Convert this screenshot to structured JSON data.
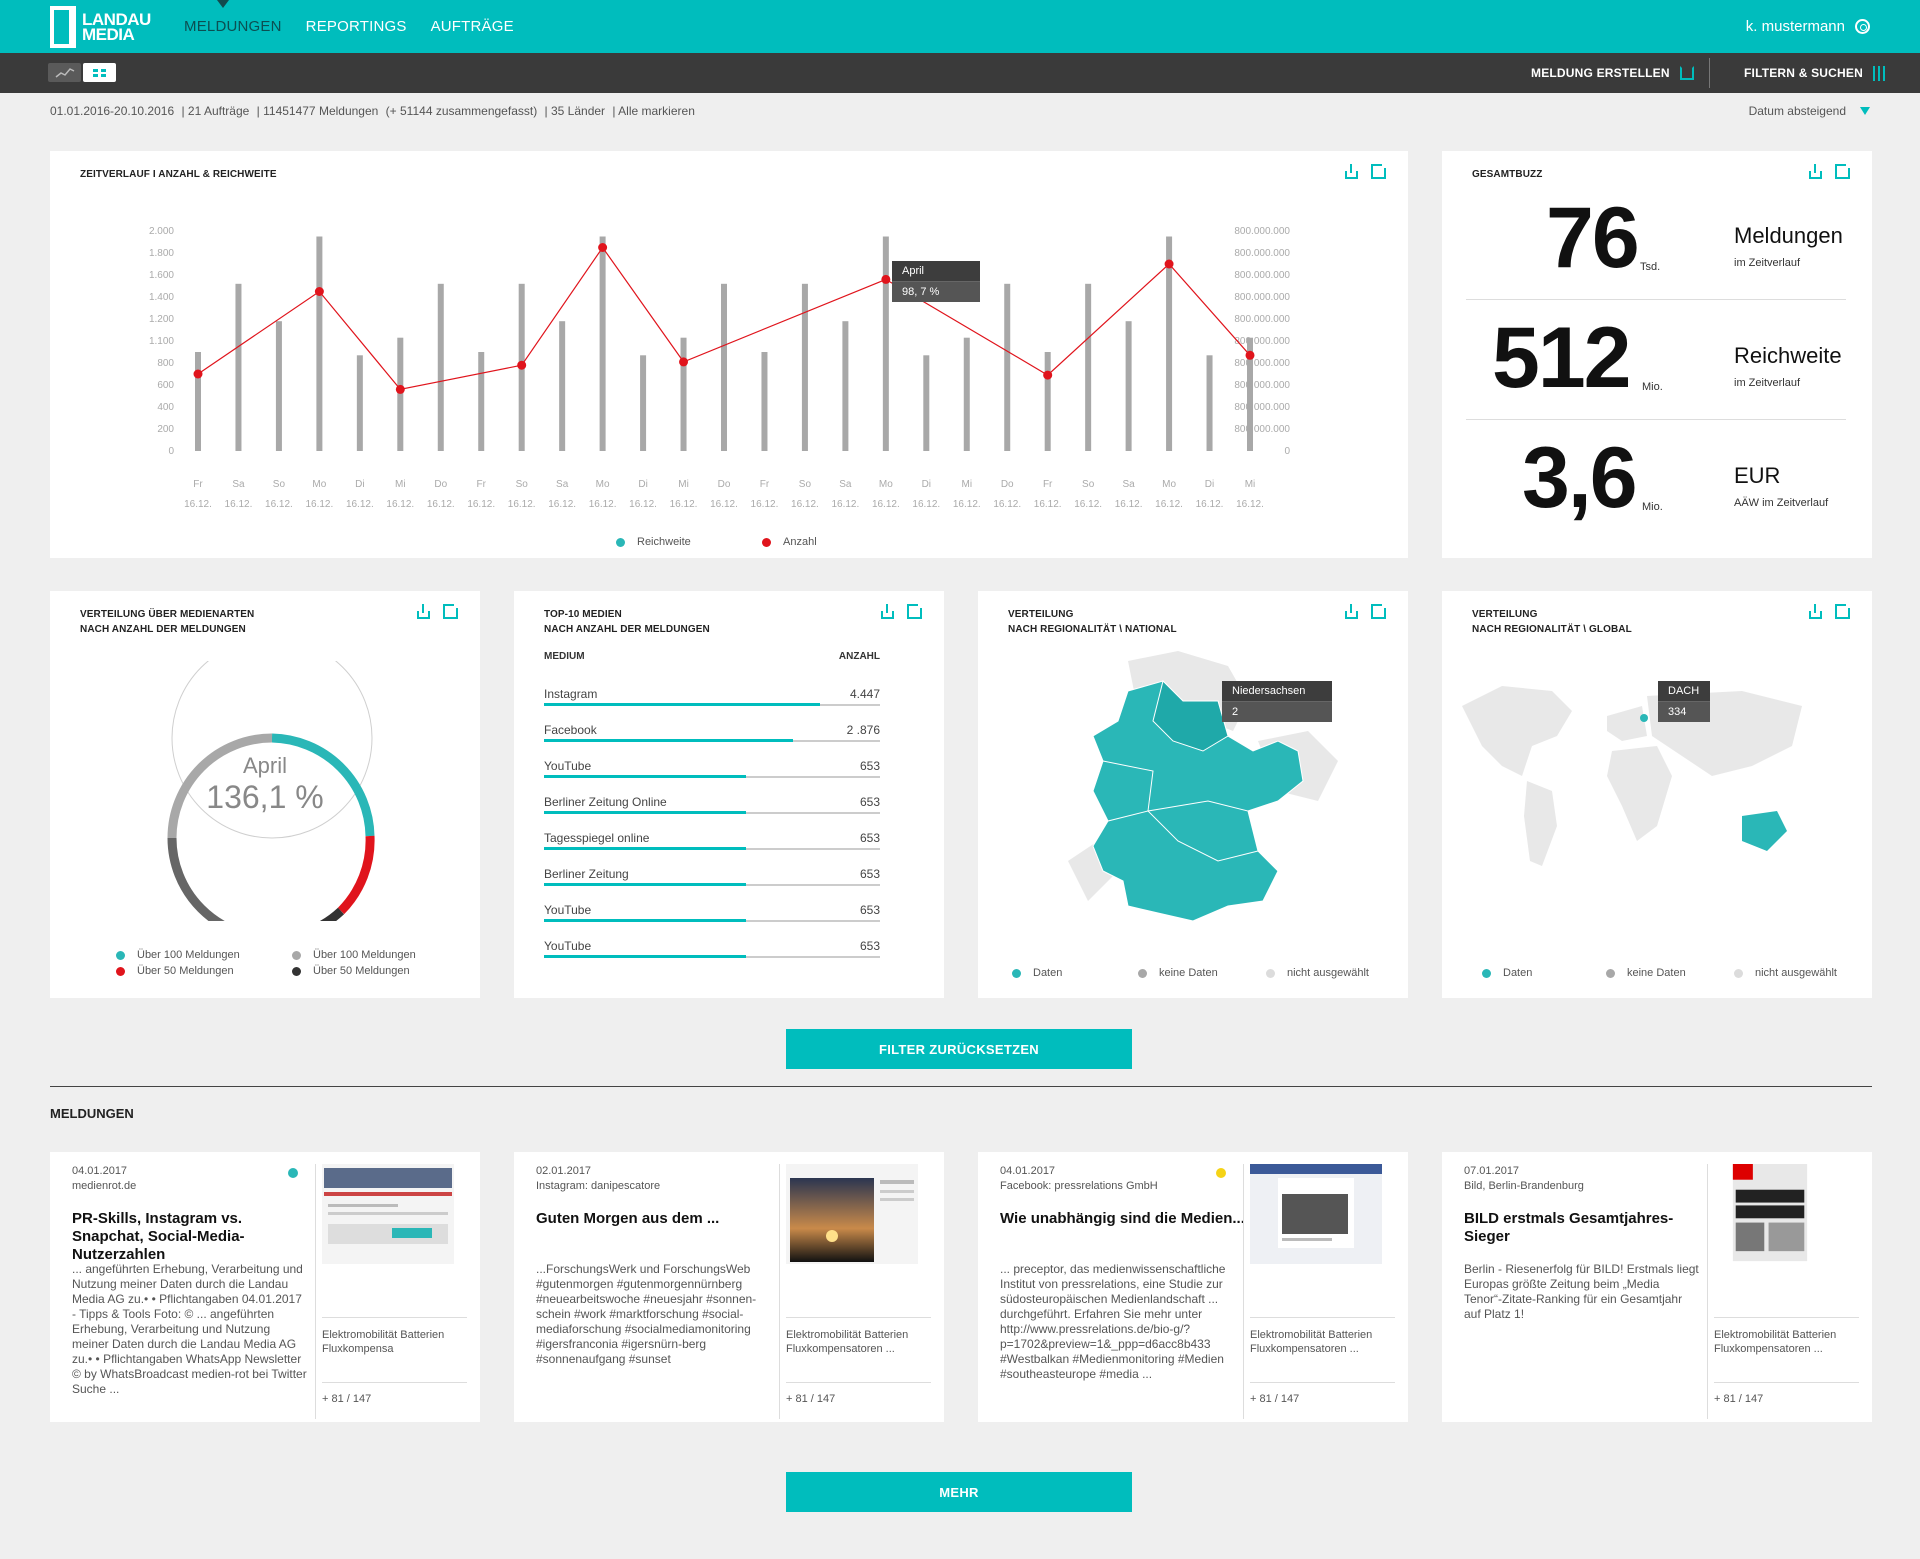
{
  "nav": {
    "logo_line1": "LANDAU",
    "logo_line2": "MEDIA",
    "items": [
      "MELDUNGEN",
      "REPORTINGS",
      "AUFTRÄGE"
    ],
    "active": "MELDUNGEN",
    "user": "k. mustermann"
  },
  "toolbar": {
    "create": "MELDUNG ERSTELLEN",
    "filter": "FILTERN & SUCHEN"
  },
  "filterline": {
    "daterange": "01.01.2016-20.10.2016",
    "auftraege": "21 Aufträge",
    "meldungen": "11451477 Meldungen",
    "summary": "(+ 51144 zusammengefasst)",
    "laender": "35 Länder",
    "mark_all": "Alle markieren",
    "sort": "Datum absteigend"
  },
  "timeline": {
    "title": "ZEITVERLAUF  I  ANZAHL & REICHWEITE",
    "tooltip_label": "April",
    "tooltip_value": "98, 7 %",
    "legend_reach": "Reichweite",
    "legend_count": "Anzahl"
  },
  "chart_data": {
    "type": "bar",
    "left_ticks": [
      "2.000",
      "1.800",
      "1.600",
      "1.400",
      "1.200",
      "1.100",
      "800",
      "600",
      "400",
      "200",
      "0"
    ],
    "right_ticks": [
      "800.000.000",
      "800.000.000",
      "800.000.000",
      "800.000.000",
      "800.000.000",
      "800.000.000",
      "800.000.000",
      "800.000.000",
      "800.000.000",
      "800.000.000",
      "0"
    ],
    "categories": [
      "Fr",
      "Sa",
      "So",
      "Mo",
      "Di",
      "Mi",
      "Do",
      "Fr",
      "So",
      "Sa",
      "Mo",
      "Di",
      "Mi",
      "Do",
      "Fr",
      "So",
      "Sa",
      "Mo",
      "Di",
      "Mi",
      "Do",
      "Fr",
      "So",
      "Sa",
      "Mo",
      "Di",
      "Mi"
    ],
    "dates": [
      "16.12.",
      "16.12.",
      "16.12.",
      "16.12.",
      "16.12.",
      "16.12.",
      "16.12.",
      "16.12.",
      "16.12.",
      "16.12.",
      "16.12.",
      "16.12.",
      "16.12.",
      "16.12.",
      "16.12.",
      "16.12.",
      "16.12.",
      "16.12.",
      "16.12.",
      "16.12.",
      "16.12.",
      "16.12.",
      "16.12.",
      "16.12.",
      "16.12.",
      "16.12.",
      "16.12."
    ],
    "series": [
      {
        "name": "Reichweite",
        "color": "#a8a8a8",
        "values": [
          900,
          1520,
          1180,
          1950,
          870,
          1030,
          1520,
          900,
          1520,
          1180,
          1950,
          870,
          1030,
          1520,
          900,
          1520,
          1180,
          1950,
          870,
          1030,
          1520,
          900,
          1520,
          1180,
          1950,
          870,
          1030
        ]
      },
      {
        "name": "Anzahl",
        "color": "#e0141c",
        "points": [
          [
            0,
            700
          ],
          [
            3,
            1450
          ],
          [
            5,
            560
          ],
          [
            8,
            780
          ],
          [
            10,
            1850
          ],
          [
            12,
            810
          ],
          [
            17,
            1560
          ],
          [
            21,
            690
          ],
          [
            24,
            1700
          ],
          [
            26,
            870
          ]
        ]
      }
    ],
    "ylim": [
      0,
      2000
    ]
  },
  "buzz": {
    "title": "GESAMTBUZZ",
    "k1_value": "76",
    "k1_unit": "Tsd.",
    "k1_label": "Meldungen",
    "k1_sub": "im Zeitverlauf",
    "k2_value": "512",
    "k2_unit": "Mio.",
    "k2_label": "Reichweite",
    "k2_sub": "im Zeitverlauf",
    "k3_value": "3,6",
    "k3_unit": "Mio.",
    "k3_label": "EUR",
    "k3_sub": "AÄW im Zeitverlauf"
  },
  "mediatypes": {
    "title1": "VERTEILUNG ÜBER MEDIENARTEN",
    "title2": "NACH ANZAHL DER MELDUNGEN",
    "center_label": "April",
    "center_value": "136,1 %",
    "legend": [
      {
        "label": "Über 100 Meldungen",
        "color": "#2ab7b7"
      },
      {
        "label": "Über 100 Meldungen",
        "color": "#a8a8a8"
      },
      {
        "label": "Über 50 Meldungen",
        "color": "#e0141c"
      },
      {
        "label": "Über 50 Meldungen",
        "color": "#333333"
      }
    ]
  },
  "top10": {
    "title1": "TOP-10 MEDIEN",
    "title2": "NACH ANZAHL DER MELDUNGEN",
    "col_medium": "MEDIUM",
    "col_count": "ANZAHL",
    "rows": [
      {
        "name": "Instagram",
        "value": "4.447",
        "fill": 0.82
      },
      {
        "name": "Facebook",
        "value": "2 .876",
        "fill": 0.74
      },
      {
        "name": "YouTube",
        "value": "653",
        "fill": 0.6
      },
      {
        "name": "Berliner Zeitung Online",
        "value": "653",
        "fill": 0.6
      },
      {
        "name": "Tagesspiegel online",
        "value": "653",
        "fill": 0.6
      },
      {
        "name": "Berliner Zeitung",
        "value": "653",
        "fill": 0.6
      },
      {
        "name": "YouTube",
        "value": "653",
        "fill": 0.6
      },
      {
        "name": "YouTube",
        "value": "653",
        "fill": 0.6
      }
    ]
  },
  "national": {
    "title1": "VERTEILUNG",
    "title2": "NACH REGIONALITÄT \\ NATIONAL",
    "tip_label": "Niedersachsen",
    "tip_value": "2",
    "legend": [
      "Daten",
      "keine Daten",
      "nicht ausgewählt"
    ]
  },
  "global": {
    "title1": "VERTEILUNG",
    "title2": "NACH REGIONALITÄT \\ GLOBAL",
    "tip_label": "DACH",
    "tip_value": "334",
    "legend": [
      "Daten",
      "keine Daten",
      "nicht ausgewählt"
    ]
  },
  "buttons": {
    "reset": "FILTER ZURÜCKSETZEN",
    "more": "MEHR"
  },
  "news": {
    "section": "MELDUNGEN",
    "items": [
      {
        "date": "04.01.2017",
        "source": "medienrot.de",
        "title": "PR-Skills, Instagram vs. Snapchat, Social-Media-Nutzerzahlen",
        "body": "... angeführten Erhebung, Verarbeitung und Nutzung meiner Daten durch die Landau Media AG zu.• • Pflichtangaben 04.01.2017 - Tipps & Tools Foto: © ... angeführten Erhebung, Verarbeitung und Nutzung meiner Daten durch die Landau Media AG zu.• • Pflichtangaben WhatsApp Newsletter © by WhatsBroadcast medien-rot bei Twitter Suche ...",
        "tags": "Elektromobilität Batterien Fluxkompensa",
        "count": "+ 81 / 147",
        "dot": "#2ab7b7"
      },
      {
        "date": "02.01.2017",
        "source": "Instagram: danipescatore",
        "title": "Guten Morgen aus dem ...",
        "body": "...ForschungsWerk und ForschungsWeb #gutenmorgen #gutenmorgennürnberg #neuearbeitswoche #neuesjahr #sonnen-schein #work #marktforschung #social-mediaforschung #socialmediamonitoring #igersfranconia #igersnürn-berg #sonnenaufgang #sunset",
        "tags": "Elektromobilität Batterien Fluxkompensatoren ...",
        "count": "+ 81 / 147",
        "dot": ""
      },
      {
        "date": "04.01.2017",
        "source": "Facebook: pressrelations GmbH",
        "title": "Wie unabhängig sind die Medien...",
        "body": "... preceptor, das medienwissenschaftliche Institut von pressrelations, eine Studie zur südosteuropäischen Medienlandschaft ... durchgeführt. Erfahren Sie mehr unter http://www.pressrelations.de/bio-g/?p=1702&preview=1&_ppp=d6acc8b433 #Westbalkan #Medienmonitoring #Medien #southeasteurope #media ...",
        "tags": "Elektromobilität Batterien Fluxkompensatoren ...",
        "count": "+ 81 / 147",
        "dot": "#f5d316"
      },
      {
        "date": "07.01.2017",
        "source": "Bild, Berlin-Brandenburg",
        "title": "BILD erstmals Gesamtjahres-Sieger",
        "body": "Berlin - Riesenerfolg für BILD! Erstmals liegt Europas größte Zeitung beim „Media Tenor“-Zitate-Ranking für ein Gesamtjahr auf Platz 1!",
        "tags": "Elektromobilität Batterien Fluxkompensatoren ...",
        "count": "+ 81 / 147",
        "dot": ""
      }
    ]
  }
}
